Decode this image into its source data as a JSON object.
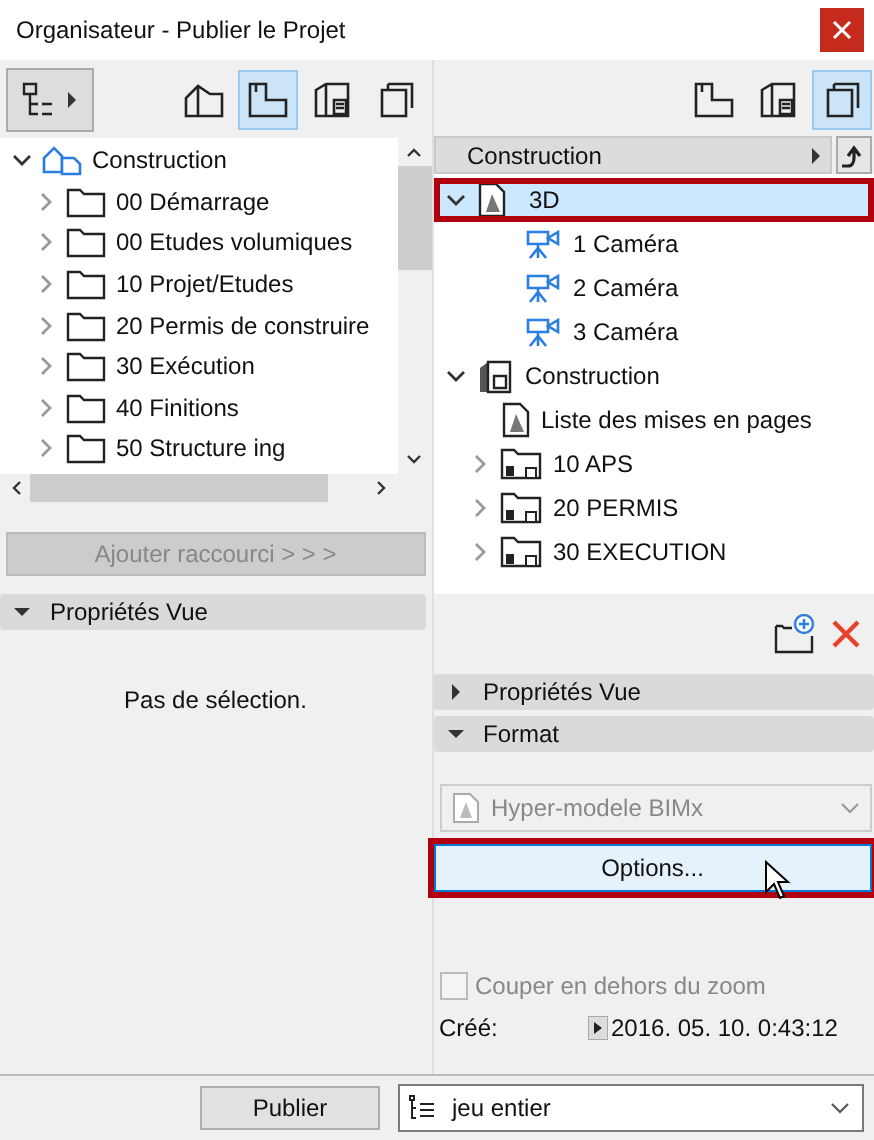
{
  "window": {
    "title": "Organisateur - Publier le Projet"
  },
  "left": {
    "view_buttons": [
      {
        "kind": "project",
        "selected": false
      },
      {
        "kind": "view",
        "selected": true
      },
      {
        "kind": "layout",
        "selected": false
      },
      {
        "kind": "publisher",
        "selected": false
      }
    ],
    "tree": {
      "label": "Construction",
      "kind": "project",
      "expanded": true,
      "children": [
        {
          "label": "00 Démarrage",
          "kind": "folder",
          "expanded": false
        },
        {
          "label": "00 Etudes volumiques",
          "kind": "folder",
          "expanded": false
        },
        {
          "label": "10 Projet/Etudes",
          "kind": "folder",
          "expanded": false
        },
        {
          "label": "20 Permis de construire",
          "kind": "folder",
          "expanded": false
        },
        {
          "label": "30 Exécution",
          "kind": "folder",
          "expanded": false
        },
        {
          "label": "40 Finitions",
          "kind": "folder",
          "expanded": false
        },
        {
          "label": "50 Structure ing",
          "kind": "folder",
          "expanded": false
        }
      ]
    },
    "add_shortcut_button": {
      "label": "Ajouter raccourci > > >",
      "disabled": true
    },
    "properties_header": {
      "label": "Propriétés Vue",
      "expanded": true
    },
    "empty_message": "Pas de sélection."
  },
  "right": {
    "view_buttons": [
      {
        "kind": "view",
        "selected": false
      },
      {
        "kind": "layout",
        "selected": false
      },
      {
        "kind": "publisher",
        "selected": true
      }
    ],
    "breadcrumb": "Construction",
    "tree": [
      {
        "label": "3D",
        "kind": "model",
        "expanded": true,
        "selected": true,
        "highlighted": true,
        "children": [
          {
            "label": "1 Caméra",
            "kind": "camera",
            "selected": false
          },
          {
            "label": "2 Caméra",
            "kind": "camera",
            "selected": false
          },
          {
            "label": "3 Caméra",
            "kind": "camera",
            "selected": false
          }
        ]
      },
      {
        "label": "Construction",
        "kind": "book",
        "expanded": true,
        "selected": false,
        "children": [
          {
            "label": "Liste des mises en pages",
            "kind": "model",
            "selected": false
          },
          {
            "label": "10 APS",
            "kind": "subset",
            "expanded": false,
            "selected": false
          },
          {
            "label": "20 PERMIS",
            "kind": "subset",
            "expanded": false,
            "selected": false
          },
          {
            "label": "30 EXECUTION",
            "kind": "subset",
            "expanded": false,
            "selected": false
          }
        ]
      }
    ],
    "sections": [
      {
        "label": "Propriétés Vue",
        "expanded": false
      },
      {
        "label": "Format",
        "expanded": true
      }
    ],
    "format_select": {
      "value": "Hyper-modele BIMx",
      "disabled": true
    },
    "options_button": {
      "label": "Options...",
      "highlighted": true
    },
    "clip_checkbox": {
      "label": "Couper en dehors  du zoom",
      "checked": false,
      "disabled": true
    },
    "created": {
      "label": "Créé:",
      "value": "2016. 05. 10. 0:43:12"
    }
  },
  "footer": {
    "publish_button": "Publier",
    "set_select": "jeu entier"
  }
}
